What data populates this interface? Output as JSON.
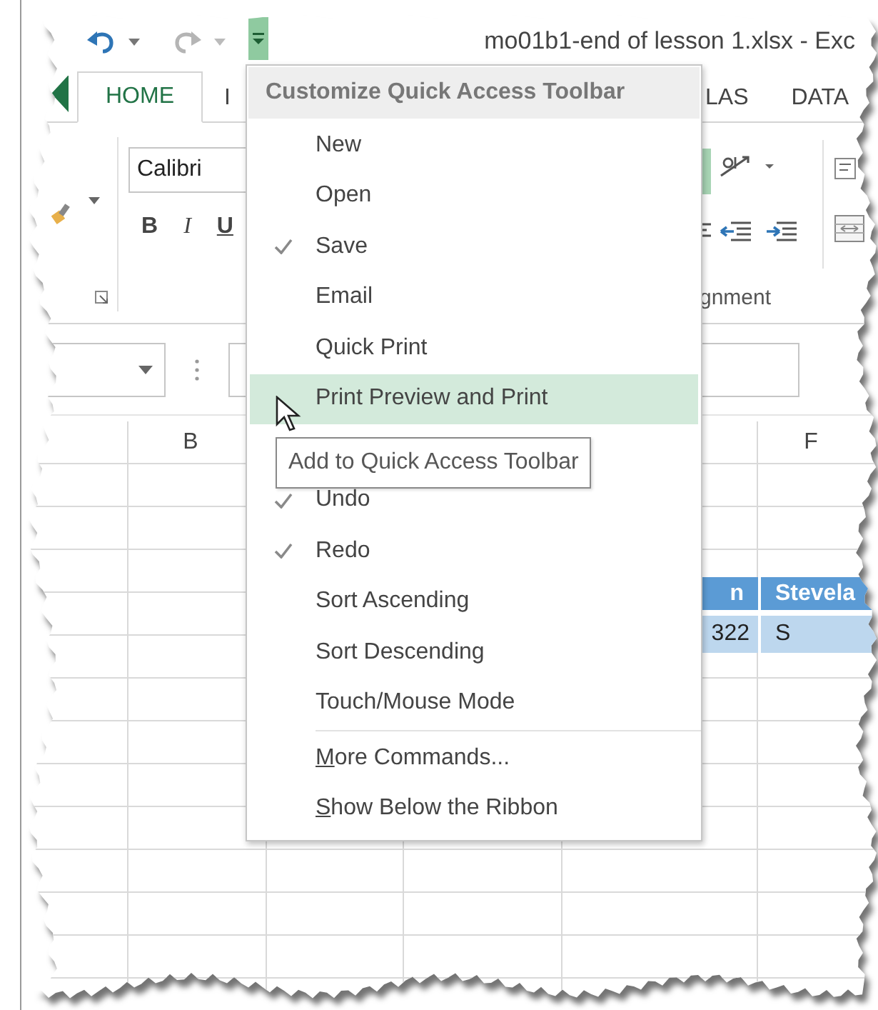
{
  "title_bar": {
    "title": "mo01b1-end of lesson 1.xlsx - Exc"
  },
  "tabs": [
    {
      "label": "HOME",
      "selected": true
    },
    {
      "label": "I",
      "selected": false
    },
    {
      "label": "LAS",
      "selected": false
    },
    {
      "label": "DATA",
      "selected": false
    }
  ],
  "ribbon": {
    "font_name": "Calibri",
    "format_buttons": [
      "B",
      "I",
      "U"
    ],
    "group_label": "gnment"
  },
  "grid": {
    "column_headers": [
      "B",
      "F"
    ],
    "cells": [
      {
        "label": "n",
        "kind": "header"
      },
      {
        "label": "Stevela",
        "kind": "header"
      },
      {
        "label": "322",
        "kind": "data"
      },
      {
        "label": "S",
        "kind": "data"
      }
    ]
  },
  "menu": {
    "title": "Customize Quick Access Toolbar",
    "items": [
      {
        "label": "New",
        "checked": false,
        "selected": false
      },
      {
        "label": "Open",
        "checked": false,
        "selected": false
      },
      {
        "label": "Save",
        "checked": true,
        "selected": false
      },
      {
        "label": "Email",
        "checked": false,
        "selected": false
      },
      {
        "label": "Quick Print",
        "checked": false,
        "selected": false
      },
      {
        "label": "Print Preview and Print",
        "checked": false,
        "selected": true
      },
      {
        "label": "Undo",
        "checked": true,
        "selected": false
      },
      {
        "label": "Redo",
        "checked": true,
        "selected": false
      },
      {
        "label": "Sort Ascending",
        "checked": false,
        "selected": false
      },
      {
        "label": "Sort Descending",
        "checked": false,
        "selected": false
      },
      {
        "label": "Touch/Mouse Mode",
        "checked": false,
        "selected": false
      }
    ],
    "commands": [
      {
        "label": "More Commands...",
        "underline_first": true
      },
      {
        "label": "Show Below the Ribbon",
        "underline_first": true
      }
    ]
  },
  "tooltip": {
    "text": "Add to Quick Access Toolbar"
  }
}
